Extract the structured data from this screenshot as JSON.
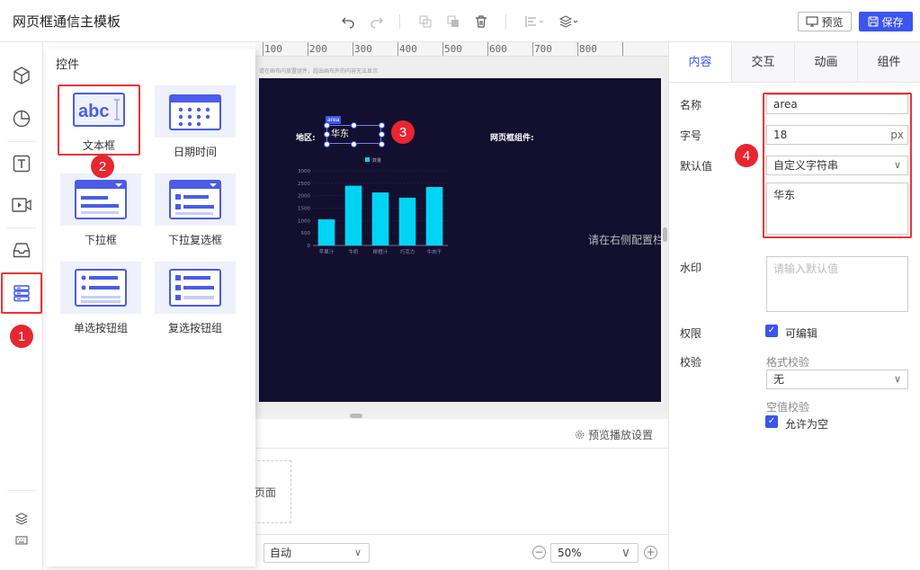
{
  "app": {
    "title": "网页框通信主模板"
  },
  "toolbar": {
    "preview_label": "预览",
    "save_label": "保存"
  },
  "flyout": {
    "title": "控件",
    "widgets": [
      {
        "label": "文本框",
        "icon": "textbox-widget-icon",
        "thumb_text": "abc"
      },
      {
        "label": "日期时间",
        "icon": "calendar-widget-icon"
      },
      {
        "label": "下拉框",
        "icon": "dropdown-widget-icon"
      },
      {
        "label": "下拉复选框",
        "icon": "dropdown-checkbox-widget-icon"
      },
      {
        "label": "单选按钮组",
        "icon": "radio-group-widget-icon"
      },
      {
        "label": "复选按钮组",
        "icon": "checkbox-group-widget-icon"
      }
    ]
  },
  "ruler": {
    "ticks": [
      "100",
      "200",
      "300",
      "400",
      "500",
      "600",
      "700",
      "800"
    ]
  },
  "canvas": {
    "hint_text": "请在画布内放置组件，超出画布外的内容无法显示",
    "region_label": "地区:",
    "frame_label": "网页框组件:",
    "param_tag": "area",
    "textbox_value": "华东",
    "config_hint": "请在右侧配置栏"
  },
  "chart_data": {
    "type": "bar",
    "categories": [
      "苹果汁",
      "牛奶",
      "柳橙汁",
      "巧克力",
      "牛肉干"
    ],
    "values": [
      1050,
      2400,
      2130,
      1920,
      2350
    ],
    "series": [
      {
        "name": "数量",
        "values": [
          1050,
          2400,
          2130,
          1920,
          2350
        ]
      }
    ],
    "yticks": [
      "0",
      "500",
      "1000",
      "1500",
      "2000",
      "2500",
      "3000"
    ],
    "ylim": [
      0,
      3000
    ],
    "bar_color": "#00d4f5",
    "axis_color": "#8890b0"
  },
  "bottom": {
    "play_settings": "预览播放设置",
    "page_label": "页面",
    "auto_select": "自动",
    "zoom_value": "50%"
  },
  "panel": {
    "tabs": [
      "内容",
      "交互",
      "动画",
      "组件"
    ],
    "name_label": "名称",
    "name_value": "area",
    "fontsize_label": "字号",
    "fontsize_value": "18",
    "fontsize_unit": "px",
    "default_label": "默认值",
    "default_type": "自定义字符串",
    "default_value": "华东",
    "watermark_label": "水印",
    "watermark_placeholder": "请输入默认值",
    "permission_label": "权限",
    "editable_label": "可编辑",
    "validation_label": "校验",
    "format_check_label": "格式校验",
    "format_check_value": "无",
    "null_check_label": "空值校验",
    "allow_null_label": "允许为空"
  },
  "badges": [
    "1",
    "2",
    "3",
    "4"
  ],
  "colors": {
    "accent": "#3b55f0",
    "annotation_red": "#e8262f",
    "canvas_bg": "#130f2e"
  }
}
